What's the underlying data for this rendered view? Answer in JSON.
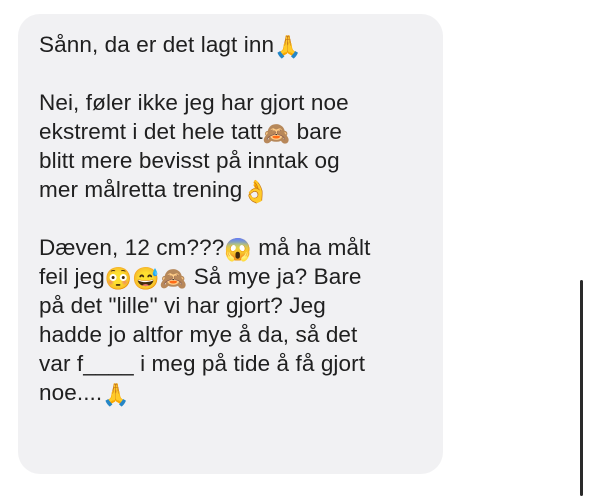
{
  "message": {
    "line_1": [
      "Sånn, da er det lagt inn",
      "🙏"
    ],
    "line_2": "Nei, føler ikke jeg har gjort noe",
    "line_3": [
      "ekstremt i det hele tatt",
      "🙈",
      " bare"
    ],
    "line_4": "blitt mere bevisst på inntak og",
    "line_5": [
      "mer målretta trening",
      "👌"
    ],
    "line_6": [
      "Dæven, 12 cm???",
      "😱",
      " må ha målt"
    ],
    "line_7": [
      "feil jeg",
      "😳",
      "😅",
      "🙈",
      " Så mye ja? Bare"
    ],
    "line_8": "på det \"lille\" vi har gjort? Jeg",
    "line_9": "hadde jo altfor mye å da, så det",
    "line_10": "var f____ i meg på tide å få gjort",
    "line_11": [
      "noe....",
      "🙏"
    ]
  },
  "colors": {
    "bubble_background": "#f1f1f3",
    "text": "#202020",
    "scrollbar": "#2a2a2a"
  }
}
